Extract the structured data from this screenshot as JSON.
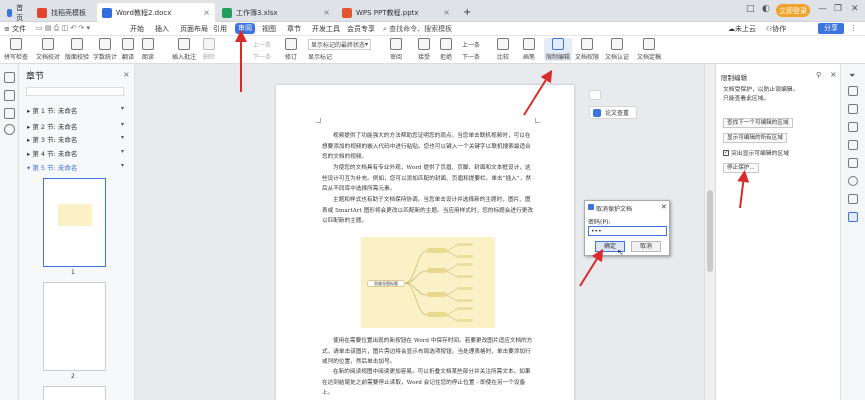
{
  "tabs": {
    "home": "首页",
    "t1": "找稻壳模板",
    "t2": "Word教程2.docx",
    "t3": "工作簿3.xlsx",
    "t4": "WPS PPT教程.pptx",
    "add": "+"
  },
  "window": {
    "grid": "□",
    "min": "—",
    "restore": "❐",
    "close": "✕"
  },
  "badge": "立即登录",
  "menu": {
    "file": "文件",
    "items": [
      "开始",
      "插入",
      "页面布局",
      "引用",
      "审阅",
      "视图",
      "章节",
      "开发工具",
      "会员专享"
    ],
    "active": "审阅",
    "search": "查找命令、搜索模板",
    "unsync": "未上云",
    "collab": "协作",
    "share": "分享"
  },
  "ribbon": {
    "spell": "拼写检查",
    "compare_doc": "文档校对",
    "layout_check": "版面校验",
    "word_count": "字数统计",
    "translate": "翻译",
    "read": "朗读",
    "insert_comment": "插入批注",
    "delete": "删除",
    "prev": "上一条",
    "next": "下一条",
    "show_markup": "显示标记的最终状态",
    "show_mark": "显示标记",
    "revise": "修订",
    "review": "审阅",
    "accept": "接受",
    "reject": "拒绝",
    "prev2": "上一条",
    "next2": "下一条",
    "compare": "比较",
    "ink": "画笔",
    "restrict": "限制编辑",
    "doc_rights": "文档权限",
    "doc_auth": "文档认证",
    "doc_final": "文档定稿"
  },
  "nav": {
    "title": "章节",
    "chapters": [
      "第 1 节: 未命名",
      "第 2 节: 未命名",
      "第 3 节: 未命名",
      "第 4 节: 未命名",
      "第 5 节: 未命名"
    ],
    "page1": "1",
    "page2": "2"
  },
  "doc": {
    "p1": "视频提供了功能强大的方法帮助您证明您的观点。当您单击联机视频时，可以在想要添加的视频的嵌入代码中进行粘贴。您也可以键入一个关键字以联机搜索最适合您的文档的视频。",
    "p2": "为使您的文档具有专业外观，Word 提供了页眉、页脚、封面和文本框设计，这些设计可互为补充。例如，您可以添加匹配的封面、页眉和提要栏。单击“插入”，然后从不同库中选择所需元素。",
    "p3": "主题和样式也有助于文档保持协调。当您单击设计并选择新的主题时，图片、图表或 SmartArt 图形将会更改以匹配新的主题。当应用样式时，您的标题会进行更改以匹配新的主题。",
    "p4": "使用在需要位置出现的新按钮在 Word 中保存时间。若要更改图片适应文档的方式，请单击该图片，图片旁边将会显示布局选项按钮。当处理表格时，单击要添加行或列的位置，然后单击加号。",
    "p5": "在新的阅读视图中阅读更加容易。可以折叠文档某些部分并关注所需文本。如果在达到结尾处之前需要停止读取，Word 会记住您的停止位置 - 即使在另一个设备上。",
    "mind_center": "思维导图标题",
    "paper_check": "论文查重"
  },
  "dialog": {
    "title": "取消保护文档",
    "label": "密码(P):",
    "value": "•••",
    "ok": "确定",
    "cancel": "取消",
    "close": "✕"
  },
  "rightpanel": {
    "title": "限制编辑",
    "desc1": "文档受保护，以防止误编辑。",
    "desc2": "只能查看此区域。",
    "btn_next": "查找下一个可编辑的区域",
    "btn_all": "显示可编辑的所有区域",
    "chk_highlight": "突出显示可编辑的区域",
    "btn_stop": "停止保护..."
  },
  "colors": {
    "accent": "#3b73e0",
    "arrow": "#d92b2b",
    "mindmap_bg": "#faf1c7"
  }
}
